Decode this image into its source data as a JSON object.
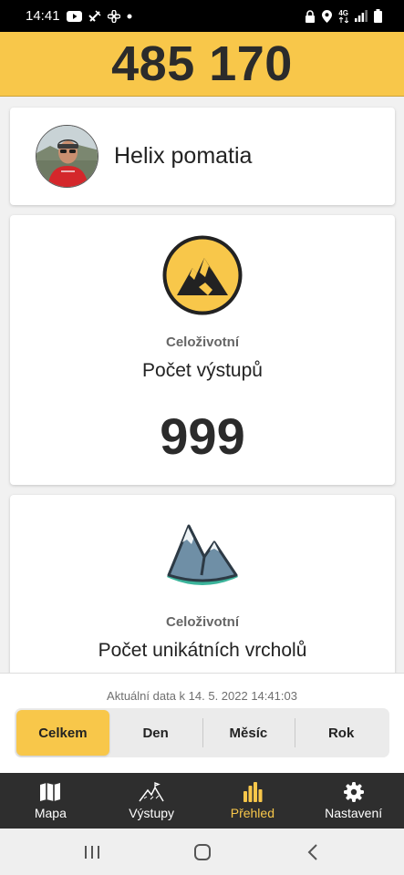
{
  "status_bar": {
    "time": "14:41",
    "icons_left": [
      "youtube-icon",
      "satellite-icon",
      "fan-icon",
      "dot-icon"
    ],
    "icons_right": [
      "lock-icon",
      "location-icon",
      "4g-icon",
      "signal-icon",
      "battery-icon"
    ],
    "network_label": "4G"
  },
  "points": {
    "value": "485 170"
  },
  "profile": {
    "name": "Helix pomatia"
  },
  "stats": [
    {
      "subtitle": "Celoživotní",
      "title": "Počet výstupů",
      "value": "999",
      "icon": "mountain-badge-icon"
    },
    {
      "subtitle": "Celoživotní",
      "title": "Počet unikátních vrcholů",
      "icon": "mountains-icon"
    }
  ],
  "footer": {
    "updated": "Aktuální data k 14. 5. 2022 14:41:03",
    "segments": [
      {
        "label": "Celkem",
        "active": true
      },
      {
        "label": "Den",
        "active": false
      },
      {
        "label": "Měsíc",
        "active": false
      },
      {
        "label": "Rok",
        "active": false
      }
    ]
  },
  "nav": [
    {
      "label": "Mapa",
      "icon": "map-icon",
      "active": false
    },
    {
      "label": "Výstupy",
      "icon": "summit-icon",
      "active": false
    },
    {
      "label": "Přehled",
      "icon": "bar-chart-icon",
      "active": true
    },
    {
      "label": "Nastavení",
      "icon": "gear-icon",
      "active": false
    }
  ],
  "colors": {
    "accent": "#f8c74a",
    "nav_bg": "#2e2e2e",
    "text": "#222222"
  }
}
